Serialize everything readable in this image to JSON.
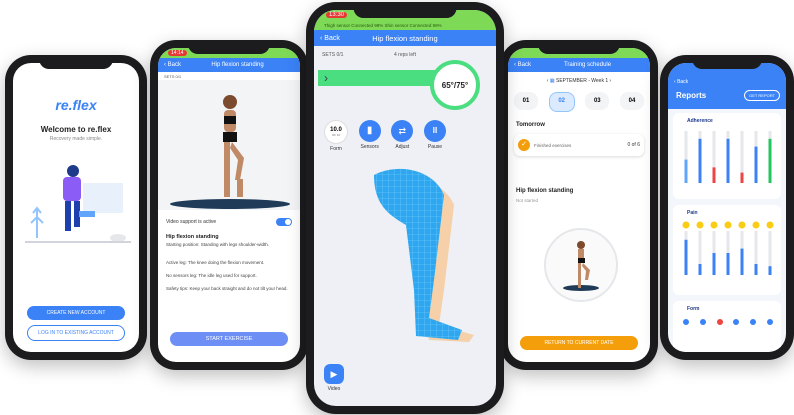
{
  "phone1": {
    "logo": "re.flex",
    "welcome": "Welcome to re.flex",
    "tagline": "Recovery made simple.",
    "create_btn": "CREATE NEW ACCOUNT",
    "login_btn": "LOG IN TO EXISTING ACCOUNT"
  },
  "phone2": {
    "time": "14:14",
    "back": "Back",
    "title": "Hip flexion standing",
    "sets": "SETS 0/1",
    "video_support": "Video support is active",
    "exercise_title": "Hip flexion standing",
    "starting": "Starting position: Standing with legs shoulder-width.",
    "active_leg": "Active leg: The knee doing the flexion movement.",
    "non_sensor": "No sensors leg: The idle leg used for support.",
    "safety": "Safety tips: Keep your back straight and do not tilt your head.",
    "start_btn": "START EXERCISE"
  },
  "phone3": {
    "time": "13:30",
    "status": "Thigh sensor Connected 98%   Shin sensor Connected 99%",
    "back": "Back",
    "title": "Hip flexion standing",
    "sets": "SETS 0/1",
    "reps_left": "4 reps left",
    "angle": "65°/75°",
    "form_value": "10.0",
    "form_sub": "OF 10",
    "buttons": [
      "Form",
      "Sensors",
      "Adjust",
      "Pause"
    ],
    "video": "Video",
    "progress": 0.82
  },
  "phone4": {
    "back": "Back",
    "title": "Training schedule",
    "month": "SEPTEMBER - Week 1",
    "days": [
      "01",
      "02",
      "03",
      "04"
    ],
    "tomorrow": "Tomorrow",
    "finished": "Finished exercises",
    "finished_count": "0 of 6",
    "exercise": "Hip flexion standing",
    "not_started": "Not started",
    "return_btn": "RETURN TO CURRENT DATE"
  },
  "phone5": {
    "back": "Back",
    "title": "Reports",
    "get_report": "GET REPORT",
    "adherence": "Adherence",
    "pain": "Pain",
    "form": "Form",
    "adherence_values": [
      0.45,
      0.85,
      0.3,
      0.85,
      0.2,
      0.7,
      0.85
    ],
    "pain_values": [
      0.8,
      0.25,
      0.5,
      0.5,
      0.6,
      0.25,
      0.2
    ]
  },
  "colors": {
    "primary": "#3b82f6",
    "accent_orange": "#f59e0b",
    "green": "#7ed957",
    "leg_blue": "#2ea7f0"
  }
}
